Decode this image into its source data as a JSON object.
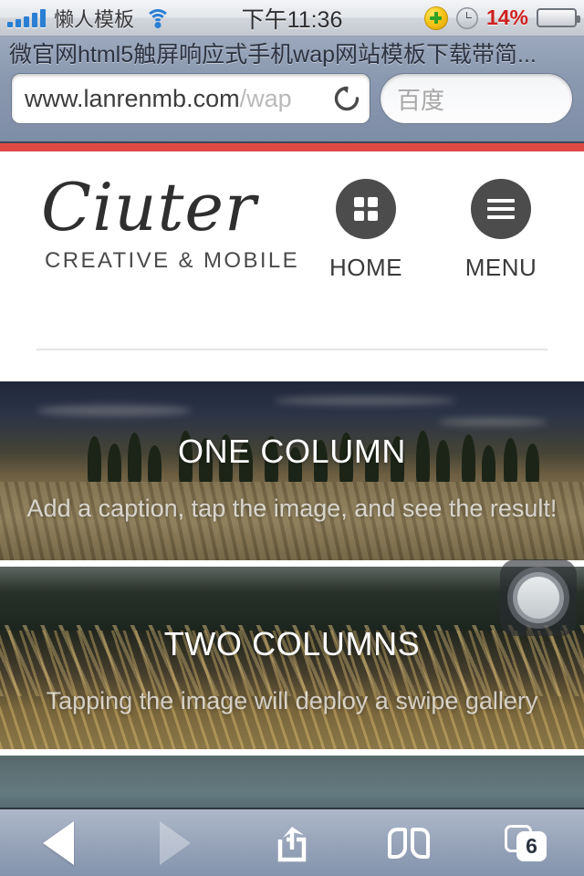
{
  "status_bar": {
    "carrier": "懒人模板",
    "signal_bars": 5,
    "wifi_icon": "wifi-icon",
    "time": "下午11:36",
    "plus_icon": "green-plus-icon",
    "clock_icon": "alarm-clock-icon",
    "battery_percent": "14%",
    "battery_level": 14
  },
  "browser": {
    "page_title": "微官网html5触屏响应式手机wap网站模板下载带简...",
    "url_main": "www.lanrenmb.com",
    "url_path": "/wap",
    "reload_icon": "reload-icon",
    "search_placeholder": "百度",
    "search_value": ""
  },
  "page": {
    "accent_color": "#e04a44",
    "header": {
      "logo": "Ciuter",
      "tagline": "CREATIVE & MOBILE",
      "nav": [
        {
          "label": "HOME",
          "icon": "grid-icon"
        },
        {
          "label": "MENU",
          "icon": "hamburger-icon"
        }
      ]
    },
    "heroes": [
      {
        "title": "ONE COLUMN",
        "caption": "Add a caption, tap the image, and see the result!"
      },
      {
        "title": "TWO COLUMNS",
        "caption": "Tapping the image will deploy a swipe gallery"
      }
    ]
  },
  "assistive_touch": {
    "icon": "assistive-touch-button"
  },
  "toolbar": {
    "back": {
      "icon": "back-arrow-icon",
      "enabled": true
    },
    "forward": {
      "icon": "forward-arrow-icon",
      "enabled": false
    },
    "share": {
      "icon": "share-icon"
    },
    "bookmarks": {
      "icon": "book-icon"
    },
    "tabs": {
      "icon": "tabs-icon",
      "count": "6"
    }
  }
}
